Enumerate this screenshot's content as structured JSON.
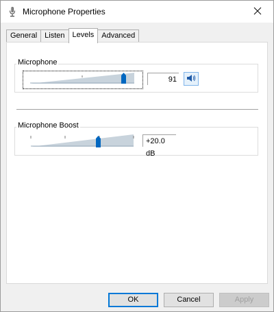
{
  "window": {
    "title": "Microphone Properties",
    "icon": "microphone-icon"
  },
  "tabs": [
    {
      "label": "General",
      "active": false
    },
    {
      "label": "Listen",
      "active": false
    },
    {
      "label": "Levels",
      "active": true
    },
    {
      "label": "Advanced",
      "active": false
    }
  ],
  "levels": {
    "microphone": {
      "label": "Microphone",
      "value": "91",
      "level": 0.91,
      "mute_icon": "speaker-icon"
    },
    "boost": {
      "label": "Microphone Boost",
      "value": "+20.0 dB",
      "level": 0.667
    }
  },
  "buttons": {
    "ok": "OK",
    "cancel": "Cancel",
    "apply": "Apply"
  },
  "colors": {
    "accent": "#0078d7",
    "thumb": "#0067c0",
    "track": "#c8d3dc"
  }
}
